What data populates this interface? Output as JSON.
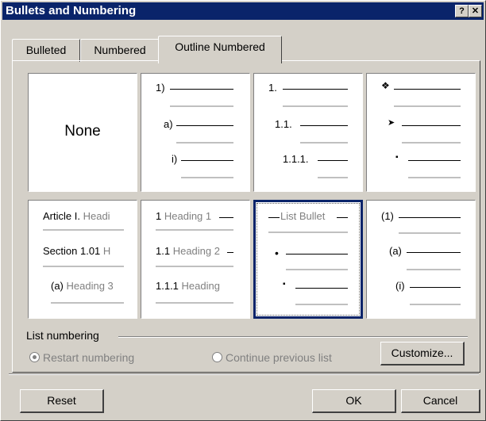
{
  "window": {
    "title": "Bullets and Numbering",
    "help_label": "?",
    "close_label": "✕"
  },
  "tabs": [
    {
      "label": "Bulleted"
    },
    {
      "label": "Numbered"
    },
    {
      "label": "Outline Numbered"
    }
  ],
  "options": {
    "none": "None",
    "opt2": {
      "l1": "1)",
      "l2": "a)",
      "l3": "i)"
    },
    "opt3": {
      "l1": "1.",
      "l2": "1.1.",
      "l3": "1.1.1."
    },
    "opt4": {
      "l1": "❖",
      "l2": "➤",
      "l3": "▪"
    },
    "opt5": {
      "l1a": "Article I.",
      "l1b": "Headi",
      "l2a": "Section 1.01",
      "l2b": "H",
      "l3a": "(a)",
      "l3b": "Heading 3"
    },
    "opt6": {
      "l1a": "1",
      "l1b": "Heading 1",
      "l2a": "1.1",
      "l2b": "Heading 2",
      "l3a": "1.1.1",
      "l3b": "Heading"
    },
    "opt7": {
      "l1": "List Bullet",
      "l2": "•",
      "l3": "▪"
    },
    "opt8": {
      "l1": "(1)",
      "l2": "(a)",
      "l3": "(i)"
    }
  },
  "list_numbering": {
    "label": "List numbering",
    "restart": "Restart numbering",
    "continue": "Continue previous list"
  },
  "buttons": {
    "customize": "Customize...",
    "reset": "Reset",
    "ok": "OK",
    "cancel": "Cancel"
  }
}
